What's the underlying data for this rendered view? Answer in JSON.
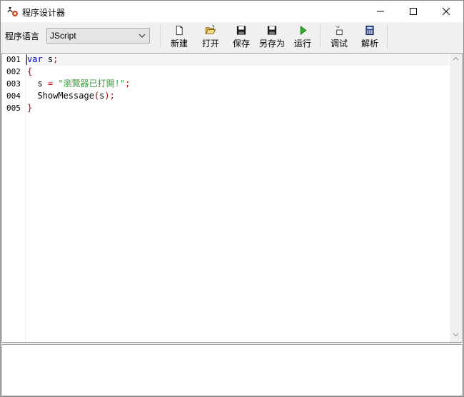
{
  "window": {
    "title": "程序设计器",
    "icon": "gear-script-icon",
    "controls": [
      "minimize-icon",
      "maximize-icon",
      "close-icon"
    ]
  },
  "toolbar": {
    "language_label": "程序语言",
    "language_value": "JScript",
    "buttons": [
      {
        "label": "新建",
        "icon": "new-file-icon"
      },
      {
        "label": "打开",
        "icon": "open-folder-icon"
      },
      {
        "label": "保存",
        "icon": "save-icon"
      },
      {
        "label": "另存为",
        "icon": "save-as-icon"
      },
      {
        "label": "运行",
        "icon": "run-icon"
      },
      {
        "label": "调试",
        "icon": "debug-icon"
      },
      {
        "label": "解析",
        "icon": "calculator-icon"
      }
    ]
  },
  "editor": {
    "line_numbers": [
      "001",
      "002",
      "003",
      "004",
      "005"
    ],
    "code": {
      "l1_kw": "var",
      "l1_rest": " s",
      "l1_punc": ";",
      "l2": "{",
      "l3_ident": "  s ",
      "l3_eq": "=",
      "l3_sp": " ",
      "l3_str": "\"瀏覽器已打開!\"",
      "l3_semi": ";",
      "l4_ident": "  ShowMessage",
      "l4_open": "(",
      "l4_arg": "s",
      "l4_close": ");",
      "l5": "}"
    }
  },
  "colors": {
    "keyword": "#0000c0",
    "punctuation": "#c00000",
    "string": "#3c9c3c"
  }
}
